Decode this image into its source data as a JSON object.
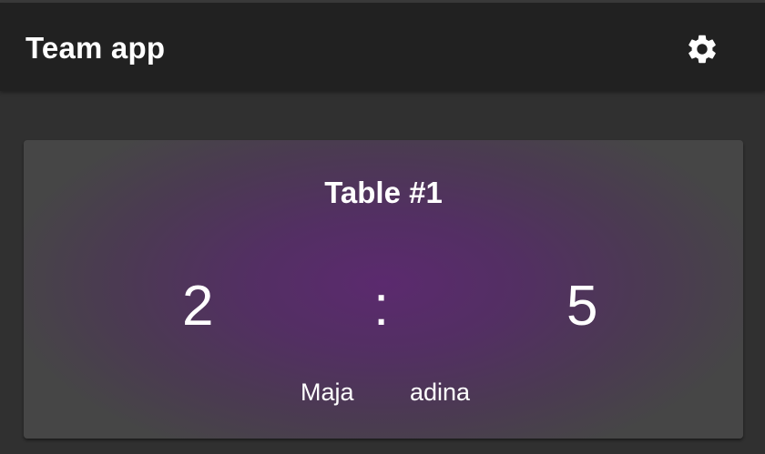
{
  "appbar": {
    "title": "Team app",
    "settings_icon": "gear-icon"
  },
  "card": {
    "title": "Table #1",
    "score_left": "2",
    "separator": ":",
    "score_right": "5",
    "player_left": "Maja",
    "player_right": "adina"
  },
  "colors": {
    "background": "#303030",
    "appbar": "#212121",
    "card_center": "#5b2a6e",
    "card_edge": "#464646",
    "text": "#ffffff"
  }
}
